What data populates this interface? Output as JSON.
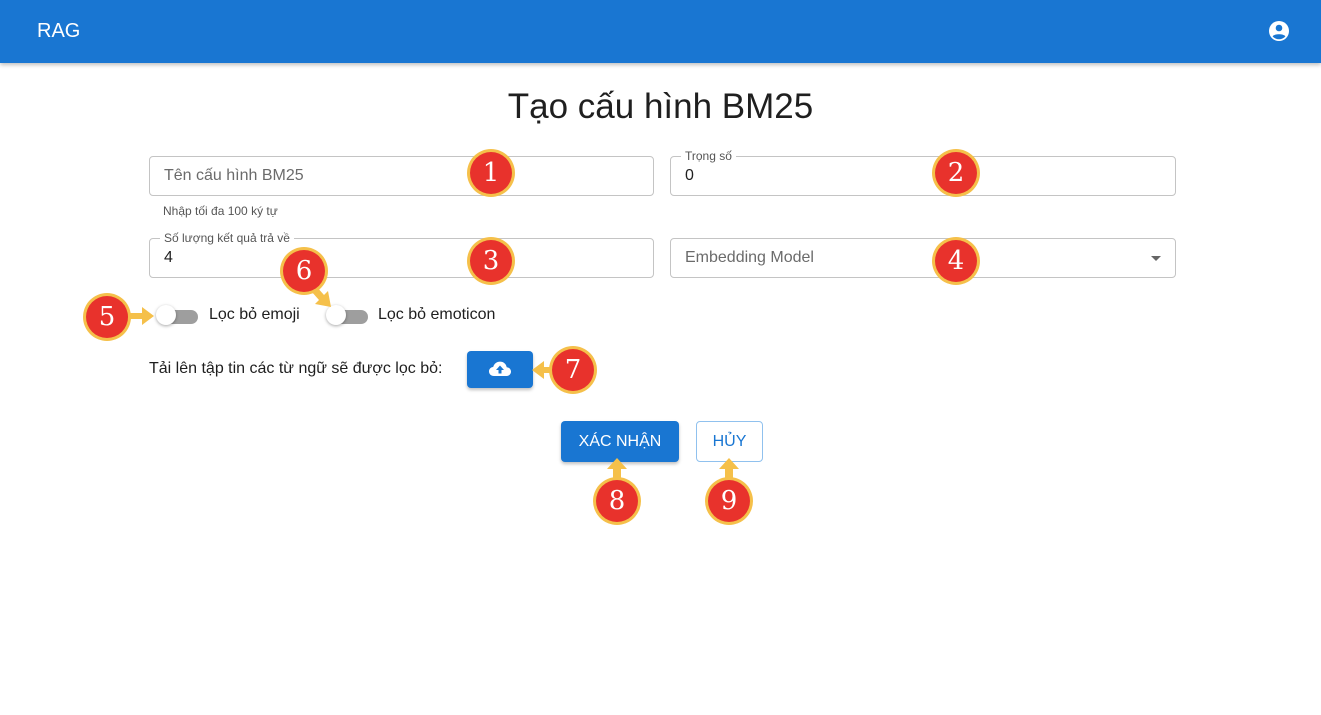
{
  "appbar": {
    "title": "RAG",
    "account_icon": "account-circle-icon"
  },
  "page": {
    "title": "Tạo cấu hình BM25"
  },
  "form": {
    "name": {
      "placeholder": "Tên cấu hình BM25",
      "value": "",
      "helper": "Nhập tối đa 100 ký tự"
    },
    "weight": {
      "label": "Trọng số",
      "value": "0"
    },
    "result_count": {
      "label": "Số lượng kết quả trả về",
      "value": "4"
    },
    "embedding_model": {
      "placeholder": "Embedding Model",
      "icon": "chevron-down-icon"
    },
    "filter_emoji": {
      "label": "Lọc bỏ emoji",
      "checked": false
    },
    "filter_emoticon": {
      "label": "Lọc bỏ emoticon",
      "checked": false
    },
    "upload": {
      "label": "Tải lên tập tin các từ ngữ sẽ được lọc bỏ:",
      "icon": "cloud-upload-icon"
    }
  },
  "actions": {
    "confirm_label": "XÁC NHẬN",
    "cancel_label": "HỦY"
  },
  "annotations": [
    "1",
    "2",
    "3",
    "4",
    "5",
    "6",
    "7",
    "8",
    "9"
  ],
  "colors": {
    "primary": "#1976d2",
    "marker": "#e8322c",
    "marker_ring": "#f5c04a",
    "switch_track": "#9e9e9e"
  }
}
